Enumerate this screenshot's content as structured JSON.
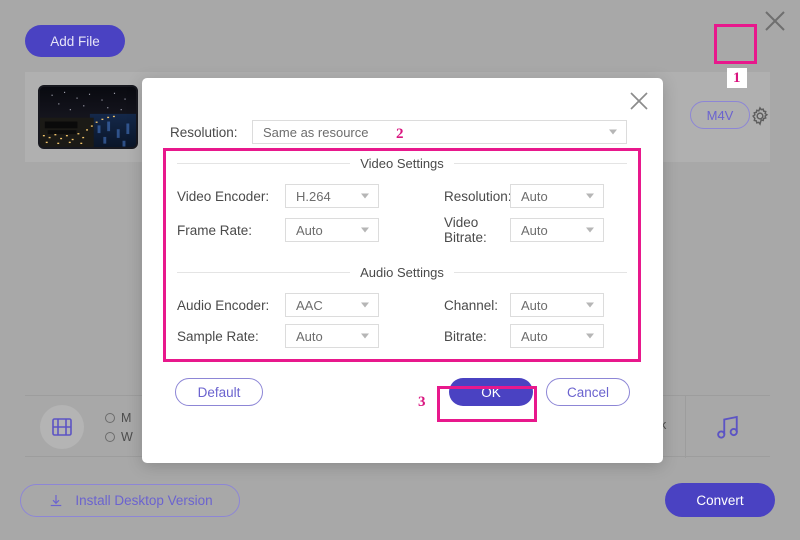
{
  "app": {
    "close_icon": "close-icon",
    "add_file_label": "Add File",
    "format_pill_label": "M4V",
    "gear_icon": "gear-icon",
    "film_icon": "film-strip-icon",
    "music_icon": "music-note-icon",
    "truncated_label": "k",
    "radio_options": [
      {
        "label": "M",
        "selected": false
      },
      {
        "label": "W",
        "selected": false
      }
    ],
    "install_label": "Install Desktop Version",
    "install_icon": "download-icon",
    "convert_label": "Convert"
  },
  "dialog": {
    "close_icon": "close-icon",
    "resolution": {
      "label": "Resolution:",
      "value": "Same as resource"
    },
    "video_section": {
      "title": "Video Settings",
      "fields": [
        {
          "label": "Video Encoder:",
          "value": "H.264"
        },
        {
          "label": "Resolution:",
          "value": "Auto"
        },
        {
          "label": "Frame Rate:",
          "value": "Auto"
        },
        {
          "label": "Video Bitrate:",
          "value": "Auto"
        }
      ]
    },
    "audio_section": {
      "title": "Audio Settings",
      "fields": [
        {
          "label": "Audio Encoder:",
          "value": "AAC"
        },
        {
          "label": "Channel:",
          "value": "Auto"
        },
        {
          "label": "Sample Rate:",
          "value": "Auto"
        },
        {
          "label": "Bitrate:",
          "value": "Auto"
        }
      ]
    },
    "buttons": {
      "default_label": "Default",
      "ok_label": "OK",
      "cancel_label": "Cancel"
    }
  },
  "annotations": {
    "step1": "1",
    "step2": "2",
    "step3": "3",
    "highlight_color": "#e8188c"
  }
}
